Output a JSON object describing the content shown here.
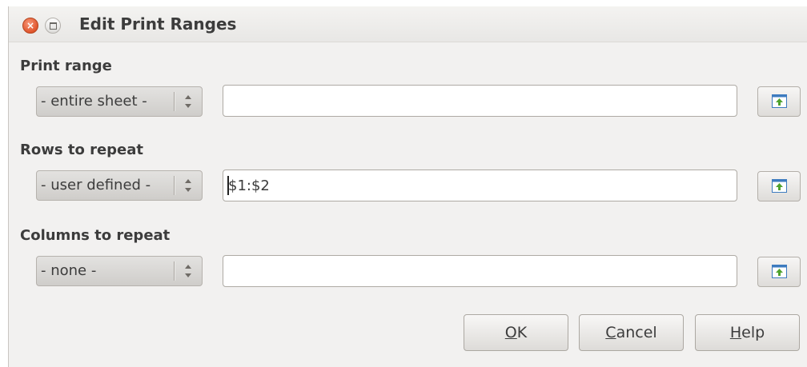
{
  "window": {
    "title": "Edit Print Ranges",
    "controls": {
      "close_glyph": "×",
      "maximize_icon": "maximize-icon"
    }
  },
  "sections": [
    {
      "label": "Print range",
      "combo_value": "- entire sheet -",
      "field_value": "",
      "shrink_icon": "shrink-icon"
    },
    {
      "label": "Rows to repeat",
      "combo_value": "- user defined -",
      "field_value": "$1:$2",
      "shrink_icon": "shrink-icon"
    },
    {
      "label": "Columns to repeat",
      "combo_value": "- none -",
      "field_value": "",
      "shrink_icon": "shrink-icon"
    }
  ],
  "buttons": {
    "ok": {
      "mnemonic": "O",
      "rest": "K"
    },
    "cancel": {
      "mnemonic": "C",
      "rest": "ancel"
    },
    "help": {
      "mnemonic": "H",
      "rest": "elp"
    }
  },
  "colors": {
    "close_button": "#e0552c",
    "shrink_icon_arrow": "#4fa22e",
    "shrink_icon_frame": "#3d7bbf"
  }
}
